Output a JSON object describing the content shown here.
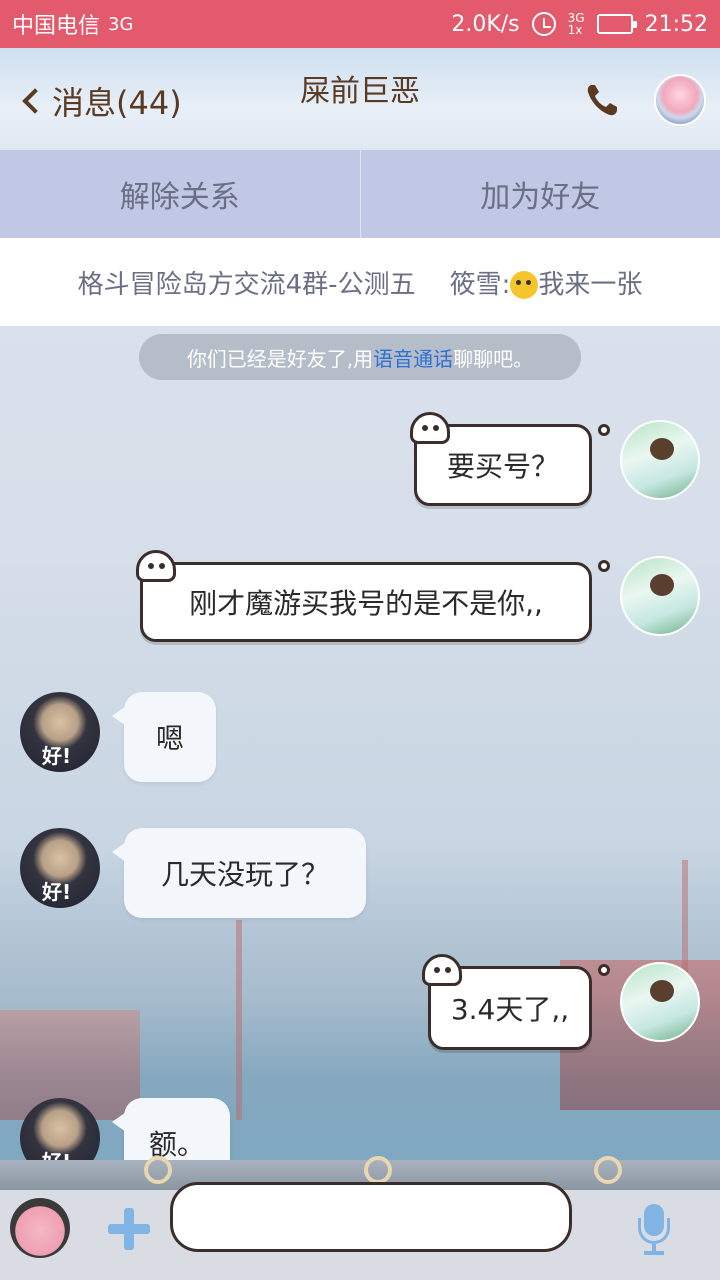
{
  "status_bar": {
    "carrier": "中国电信",
    "network": "3G",
    "speed": "2.0K/s",
    "signal_top": "3G",
    "signal_bottom": "1x",
    "time": "21:52"
  },
  "header": {
    "back_label": "消息(44)",
    "title": "屎前巨恶",
    "phone_icon": "phone-icon",
    "avatar_icon": "pig-avatar-icon"
  },
  "actions": [
    {
      "label": "解除关系"
    },
    {
      "label": "加为好友"
    }
  ],
  "group_ticker": {
    "group": "格斗冒险岛方交流4群-公测五",
    "sender": "筱雪:",
    "message": "我来一张"
  },
  "system_tip": {
    "prefix": "你们已经是好友了,用",
    "link": "语音通话",
    "suffix": "聊聊吧。"
  },
  "messages": [
    {
      "direction": "out",
      "text": "要买号？"
    },
    {
      "direction": "out",
      "text": "刚才魔游买我号的是不是你,,"
    },
    {
      "direction": "in",
      "text": "嗯",
      "avatar_text": "好!"
    },
    {
      "direction": "in",
      "text": "几天没玩了？",
      "avatar_text": "好!"
    },
    {
      "direction": "out",
      "text": "3.4天了,,"
    },
    {
      "direction": "in",
      "text": "额。",
      "avatar_text": "好!"
    }
  ],
  "input_bar": {
    "placeholder": "",
    "value": ""
  },
  "colors": {
    "status_bar": "#e35a6c",
    "action_bar": "#c0c8e6",
    "link": "#2f6fd6",
    "title_text": "#5a3a22"
  }
}
